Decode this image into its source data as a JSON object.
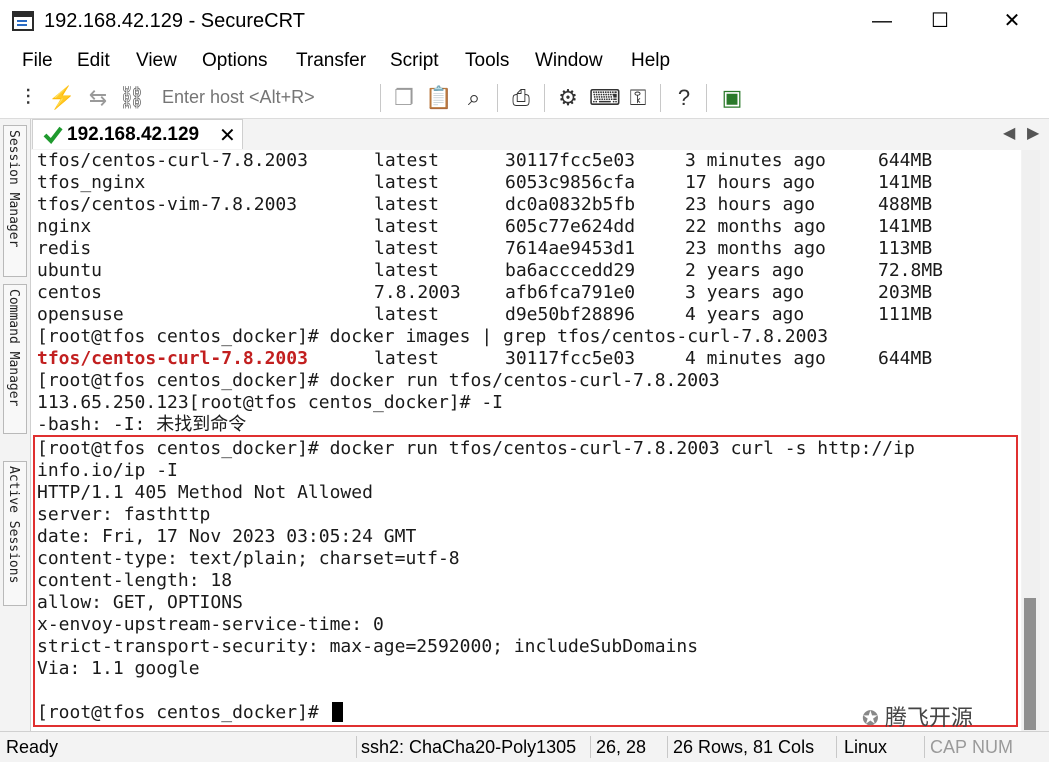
{
  "window": {
    "title": "192.168.42.129 - SecureCRT",
    "minimize": "—",
    "maximize": "☐",
    "close": "✕"
  },
  "menu": [
    "File",
    "Edit",
    "View",
    "Options",
    "Transfer",
    "Script",
    "Tools",
    "Window",
    "Help"
  ],
  "toolbar": {
    "host_placeholder": "Enter host <Alt+R>"
  },
  "sidebar": {
    "session_manager": "Session Manager",
    "command_manager": "Command Manager",
    "active_sessions": "Active Sessions"
  },
  "tab": {
    "label": "192.168.42.129",
    "close": "✕",
    "nav_left": "◀",
    "nav_right": "▶"
  },
  "terminal": {
    "image_rows": [
      {
        "repo": "tfos/centos-curl-7.8.2003",
        "tag": "latest",
        "id": "30117fcc5e03",
        "created": "3 minutes ago",
        "size": "644MB"
      },
      {
        "repo": "tfos_nginx",
        "tag": "latest",
        "id": "6053c9856cfa",
        "created": "17 hours ago",
        "size": "141MB"
      },
      {
        "repo": "tfos/centos-vim-7.8.2003",
        "tag": "latest",
        "id": "dc0a0832b5fb",
        "created": "23 hours ago",
        "size": "488MB"
      },
      {
        "repo": "nginx",
        "tag": "latest",
        "id": "605c77e624dd",
        "created": "22 months ago",
        "size": "141MB"
      },
      {
        "repo": "redis",
        "tag": "latest",
        "id": "7614ae9453d1",
        "created": "23 months ago",
        "size": "113MB"
      },
      {
        "repo": "ubuntu",
        "tag": "latest",
        "id": "ba6acccedd29",
        "created": "2 years ago",
        "size": "72.8MB"
      },
      {
        "repo": "centos",
        "tag": "7.8.2003",
        "id": "afb6fca791e0",
        "created": "3 years ago",
        "size": "203MB"
      },
      {
        "repo": "opensuse",
        "tag": "latest",
        "id": "d9e50bf28896",
        "created": "4 years ago",
        "size": "111MB"
      }
    ],
    "grep_cmd": "[root@tfos centos_docker]# docker images | grep tfos/centos-curl-7.8.2003",
    "grep_result": {
      "repo": "tfos/centos-curl-7.8.2003",
      "tag": "latest",
      "id": "30117fcc5e03",
      "created": "4 minutes ago",
      "size": "644MB"
    },
    "run_cmd": "[root@tfos centos_docker]# docker run tfos/centos-curl-7.8.2003",
    "run_output": "113.65.250.123[root@tfos centos_docker]# -I",
    "bash_error": "-bash: -I: 未找到命令",
    "output_lines": [
      "[root@tfos centos_docker]# docker run tfos/centos-curl-7.8.2003 curl -s http://ip",
      "info.io/ip -I",
      "HTTP/1.1 405 Method Not Allowed",
      "server: fasthttp",
      "date: Fri, 17 Nov 2023 03:05:24 GMT",
      "content-type: text/plain; charset=utf-8",
      "content-length: 18",
      "allow: GET, OPTIONS",
      "x-envoy-upstream-service-time: 0",
      "strict-transport-security: max-age=2592000; includeSubDomains",
      "Via: 1.1 google",
      ""
    ],
    "prompt": "[root@tfos centos_docker]# "
  },
  "watermark": "腾飞开源",
  "status": {
    "ready": "Ready",
    "cipher": "ssh2: ChaCha20-Poly1305",
    "position": "26, 28",
    "size": "26 Rows, 81 Cols",
    "os": "Linux",
    "cap": "CAP",
    "num": "NUM"
  }
}
